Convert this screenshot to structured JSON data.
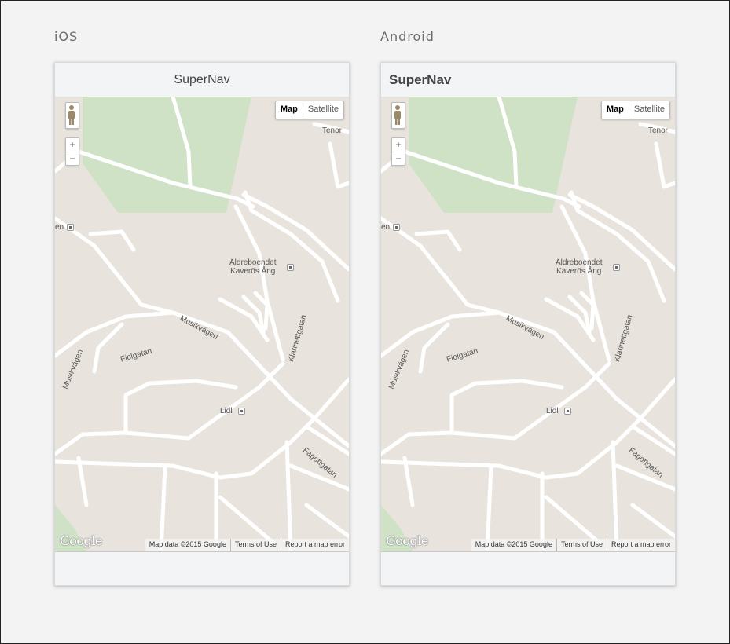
{
  "labels": {
    "ios": "iOS",
    "android": "Android"
  },
  "app": {
    "title": "SuperNav"
  },
  "map": {
    "type_buttons": {
      "map": "Map",
      "satellite": "Satellite"
    },
    "zoom": {
      "in": "+",
      "out": "−"
    },
    "streets": {
      "tenor": "Tenor",
      "en": "en",
      "musikvagen_1": "Musikvägen",
      "musikvagen_2": "Musikvägen",
      "fiolgatan": "Fiolgatan",
      "klarinettgatan": "Klarinettgatan",
      "fagottgatan": "Fagottgatan"
    },
    "poi": {
      "aldreboendet_1": "Äldreboendet",
      "aldreboendet_2": "Kaverös Ång",
      "lidl": "Lidl"
    },
    "attribution": {
      "data": "Map data ©2015 Google",
      "terms": "Terms of Use",
      "report": "Report a map error"
    },
    "logo": "Google",
    "colors": {
      "land": "#e8e4dd",
      "park": "#cfe2c6",
      "road": "#ffffff"
    }
  }
}
